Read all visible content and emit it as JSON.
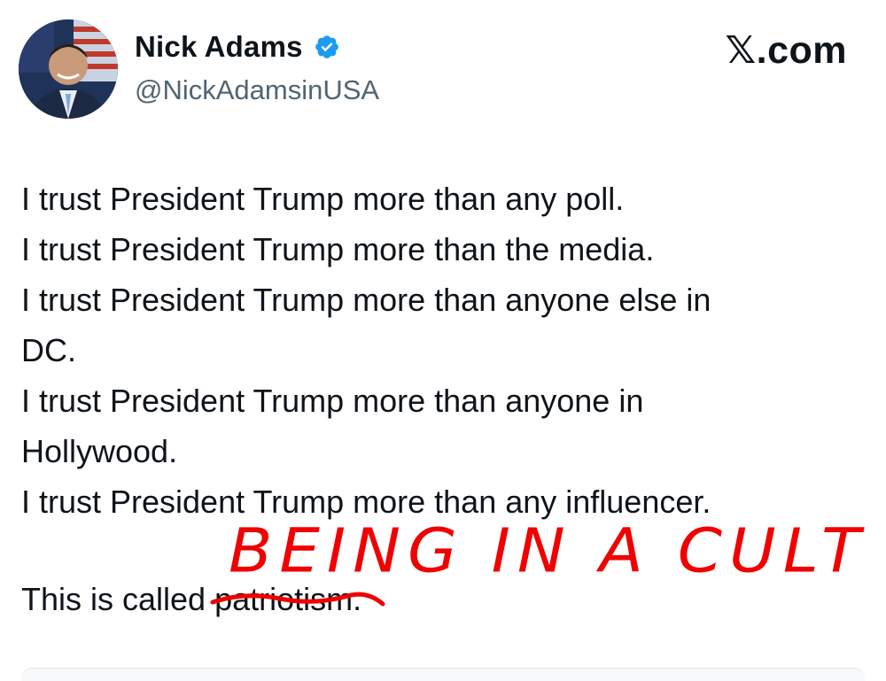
{
  "author": {
    "display_name": "Nick Adams",
    "handle": "@NickAdamsinUSA",
    "verified_icon": "verified-badge-icon",
    "badge_color": "#1d9bf0"
  },
  "brand": {
    "label": "𝕏.com"
  },
  "tweet": {
    "lines": [
      "I trust President Trump more than any poll.",
      "I trust President Trump more than the media.",
      "I trust President Trump more than anyone else in",
      "DC.",
      "I trust President Trump more than anyone in",
      "Hollywood.",
      "I trust President Trump more than any influencer."
    ],
    "closing_prefix": "This is called ",
    "closing_struck_word": "patriotism",
    "closing_suffix": "."
  },
  "annotation": {
    "text": "BEING IN A CULT",
    "color": "#f00000"
  }
}
